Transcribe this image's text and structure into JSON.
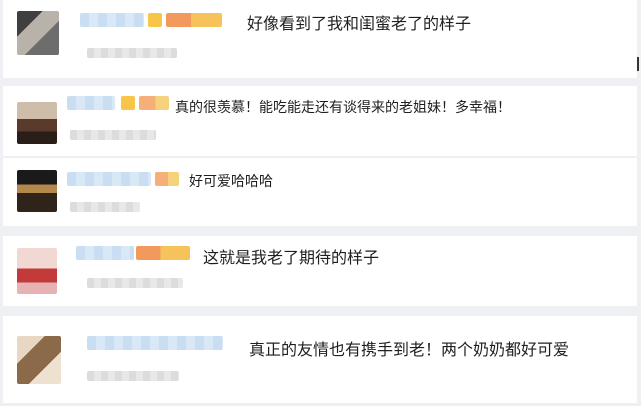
{
  "comments": [
    {
      "text": "好像看到了我和闺蜜老了的样子",
      "avatar_colors": [
        "#4a4a4a",
        "#b8b0a8",
        "#6f6f6f"
      ]
    },
    {
      "text": "真的很羡慕！能吃能走还有谈得来的老姐妹！多幸福！",
      "avatar_colors": [
        "#c8b7a6",
        "#5a3a2a",
        "#2a1e18"
      ]
    },
    {
      "text": "好可爱哈哈哈",
      "avatar_colors": [
        "#1a1a1a",
        "#b4874a",
        "#3a2a1e"
      ]
    },
    {
      "text": "这就是我老了期待的样子",
      "avatar_colors": [
        "#f3d6d0",
        "#c23a3a",
        "#e7b4b4"
      ]
    },
    {
      "text": "真正的友情也有携手到老！两个奶奶都好可爱",
      "avatar_colors": [
        "#d9c4a8",
        "#8b6a4a",
        "#efe1cf"
      ]
    }
  ]
}
